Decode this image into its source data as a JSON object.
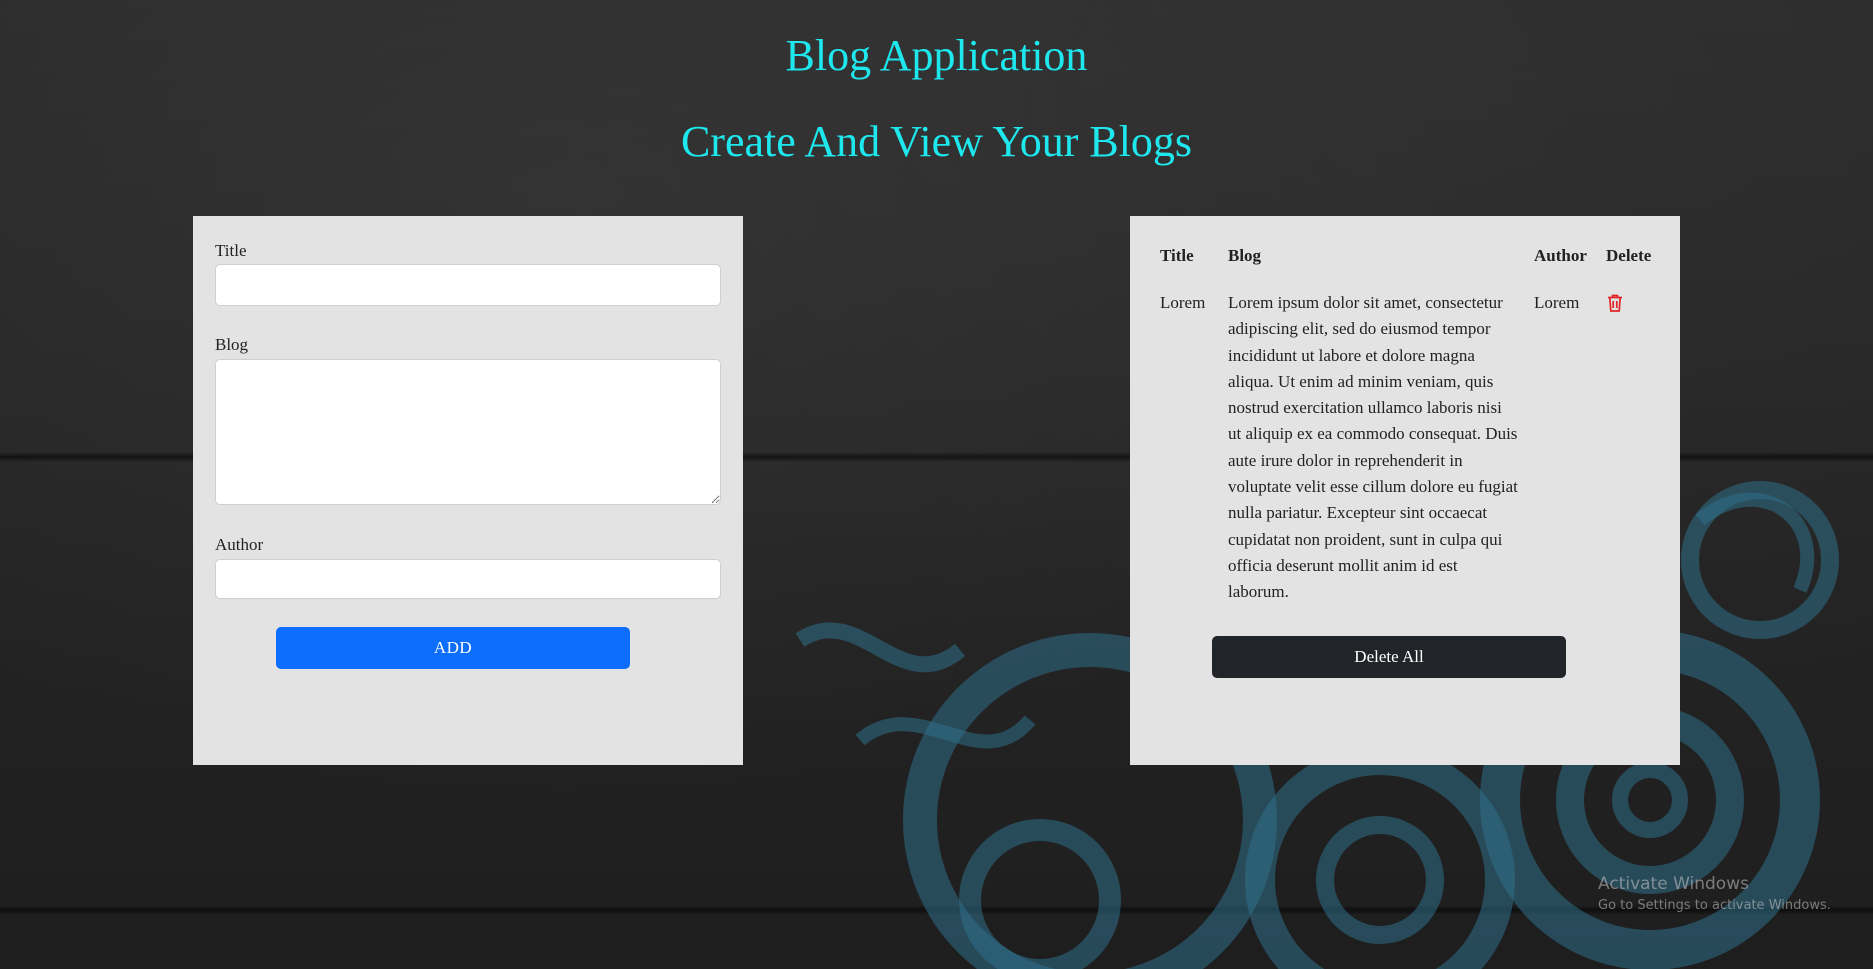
{
  "header": {
    "title": "Blog Application",
    "subtitle": "Create And View Your Blogs"
  },
  "form": {
    "title_label": "Title",
    "title_value": "",
    "blog_label": "Blog",
    "blog_value": "",
    "author_label": "Author",
    "author_value": "",
    "add_label": "ADD"
  },
  "table": {
    "headers": [
      "Title",
      "Blog",
      "Author",
      "Delete"
    ],
    "rows": [
      {
        "title": "Lorem",
        "blog": "Lorem ipsum dolor sit amet, consectetur adipiscing elit, sed do eiusmod tempor incididunt ut labore et dolore magna aliqua. Ut enim ad minim veniam, quis nostrud exercitation ullamco laboris nisi ut aliquip ex ea commodo consequat. Duis aute irure dolor in reprehenderit in voluptate velit esse cillum dolore eu fugiat nulla pariatur. Excepteur sint occaecat cupidatat non proident, sunt in culpa qui officia deserunt mollit anim id est laborum.",
        "author": "Lorem",
        "delete_icon": "trash-icon"
      }
    ],
    "delete_all_label": "Delete All"
  },
  "watermark": {
    "title": "Activate Windows",
    "subtitle": "Go to Settings to activate Windows."
  },
  "colors": {
    "heading": "#1ee8ee",
    "panel": "#e3e3e3",
    "add_button": "#0d6efd",
    "delete_all_button": "#212529",
    "trash_icon": "#e02424"
  }
}
